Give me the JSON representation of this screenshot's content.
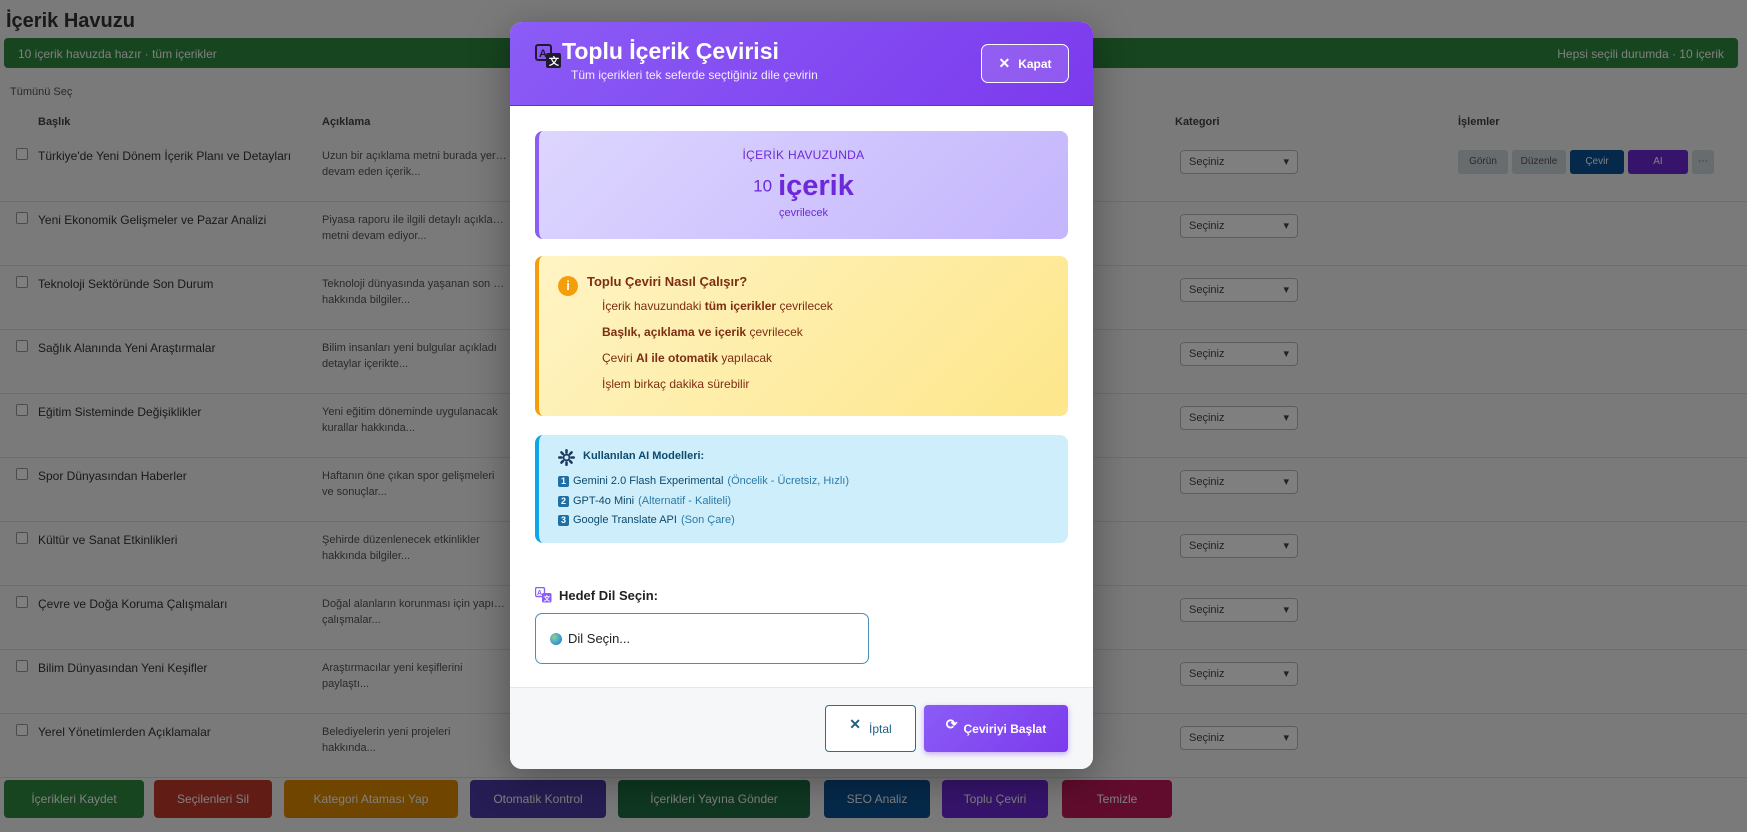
{
  "modal": {
    "title": "Toplu İçerik Çevirisi",
    "subtitle": "Tüm içerikleri tek seferde seçtiğiniz dile çevirin",
    "close_label": "Kapat",
    "pool": {
      "label": "İÇERİK HAVUZUNDA",
      "count": "10",
      "unit": "içerik",
      "sub": "çevrilecek"
    },
    "how": {
      "title": "Toplu Çeviri Nasıl Çalışır?",
      "items": [
        {
          "a": "İçerik havuzundaki ",
          "b": "tüm içerikler",
          "c": " çevrilecek"
        },
        {
          "a": "",
          "b": "Başlık, açıklama ve içerik",
          "c": " çevrilecek"
        },
        {
          "a": "Çeviri ",
          "b": "AI ile otomatik",
          "c": " yapılacak"
        },
        {
          "a": "İşlem birkaç dakika sürebilir",
          "b": "",
          "c": ""
        }
      ]
    },
    "ai": {
      "title": "Kullanılan AI Modelleri:",
      "models": [
        {
          "num": "1",
          "name": "Gemini 2.0 Flash Experimental",
          "note": "(Öncelik - Ücretsiz, Hızlı)"
        },
        {
          "num": "2",
          "name": "GPT-4o Mini",
          "note": "(Alternatif - Kaliteli)"
        },
        {
          "num": "3",
          "name": "Google Translate API",
          "note": "(Son Çare)"
        }
      ]
    },
    "language": {
      "label": "Hedef Dil Seçin:",
      "placeholder": "Dil Seçin..."
    },
    "footer": {
      "cancel_label": "İptal",
      "start_label": "Çeviriyi Başlat"
    }
  },
  "colors": {
    "accent": "#7c3aed",
    "warning": "#f59e0b",
    "info": "#0ea5e9"
  }
}
